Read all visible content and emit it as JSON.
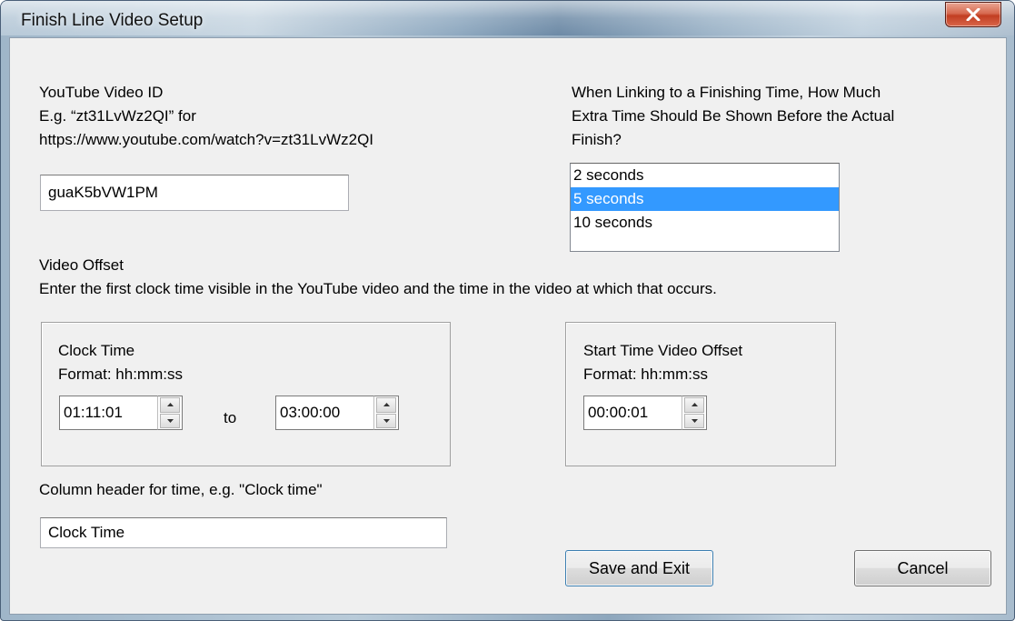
{
  "window": {
    "title": "Finish Line Video Setup"
  },
  "youtube": {
    "label_line1": "YouTube Video ID",
    "label_line2": "E.g. “zt31LvWz2QI” for",
    "label_line3": "https://www.youtube.com/watch?v=zt31LvWz2QI",
    "video_id_value": "guaK5bVW1PM"
  },
  "extra_time": {
    "question_line1": "When Linking to a Finishing Time, How Much",
    "question_line2": "Extra Time Should Be Shown Before the Actual",
    "question_line3": "Finish?",
    "options": [
      "2 seconds",
      "5 seconds",
      "10 seconds"
    ],
    "selected": "5 seconds"
  },
  "video_offset": {
    "heading": "Video Offset",
    "description": "Enter the first clock time visible in the YouTube video and the time in the video at which that occurs."
  },
  "clock_time": {
    "label": "Clock Time",
    "format": "Format: hh:mm:ss",
    "from_value": "01:11:01",
    "to_label": "to",
    "to_value": "03:00:00"
  },
  "start_offset": {
    "label": "Start Time Video Offset",
    "format": "Format: hh:mm:ss",
    "value": "00:00:01"
  },
  "column_header": {
    "label": "Column header for time, e.g. \"Clock time\"",
    "value": "Clock Time"
  },
  "buttons": {
    "save_exit": "Save and Exit",
    "cancel": "Cancel"
  },
  "colors": {
    "selection": "#3399ff",
    "close_button": "#c74a2e"
  }
}
